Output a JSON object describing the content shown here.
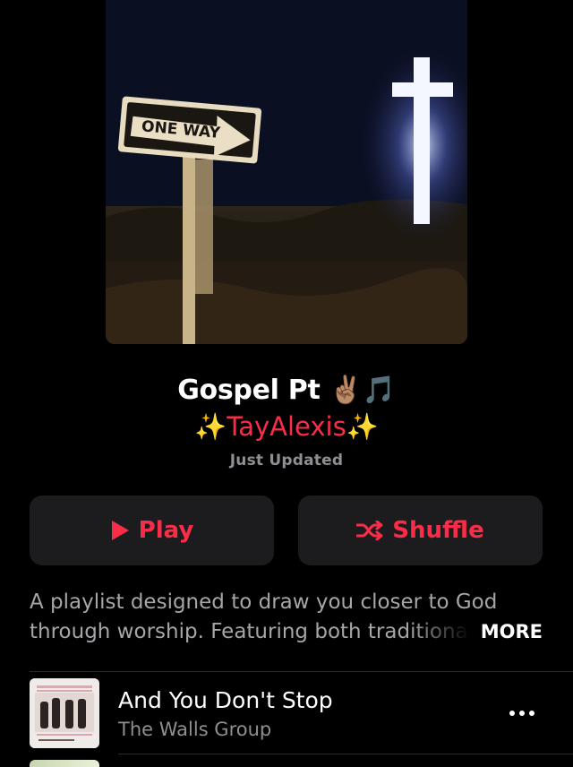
{
  "playlist": {
    "title": "Gospel Pt ✌🏽🎵",
    "curator": "✨TayAlexis✨",
    "status": "Just Updated",
    "artwork_sign_text": "ONE WAY"
  },
  "actions": {
    "play_label": "Play",
    "shuffle_label": "Shuffle"
  },
  "description": {
    "line1": "A playlist designed to draw you closer to God",
    "line2": "through worship. Featuring both traditional and",
    "more_label": "MORE"
  },
  "tracks": [
    {
      "title": "And You Don't Stop",
      "artist": "The Walls Group"
    }
  ],
  "colors": {
    "accent": "#fa2d48",
    "background": "#000000",
    "button_bg": "#1c1c1e",
    "secondary_text": "#8e8e93"
  },
  "icons": {
    "play": "play-icon",
    "shuffle": "shuffle-icon",
    "more": "more-dots-icon"
  }
}
